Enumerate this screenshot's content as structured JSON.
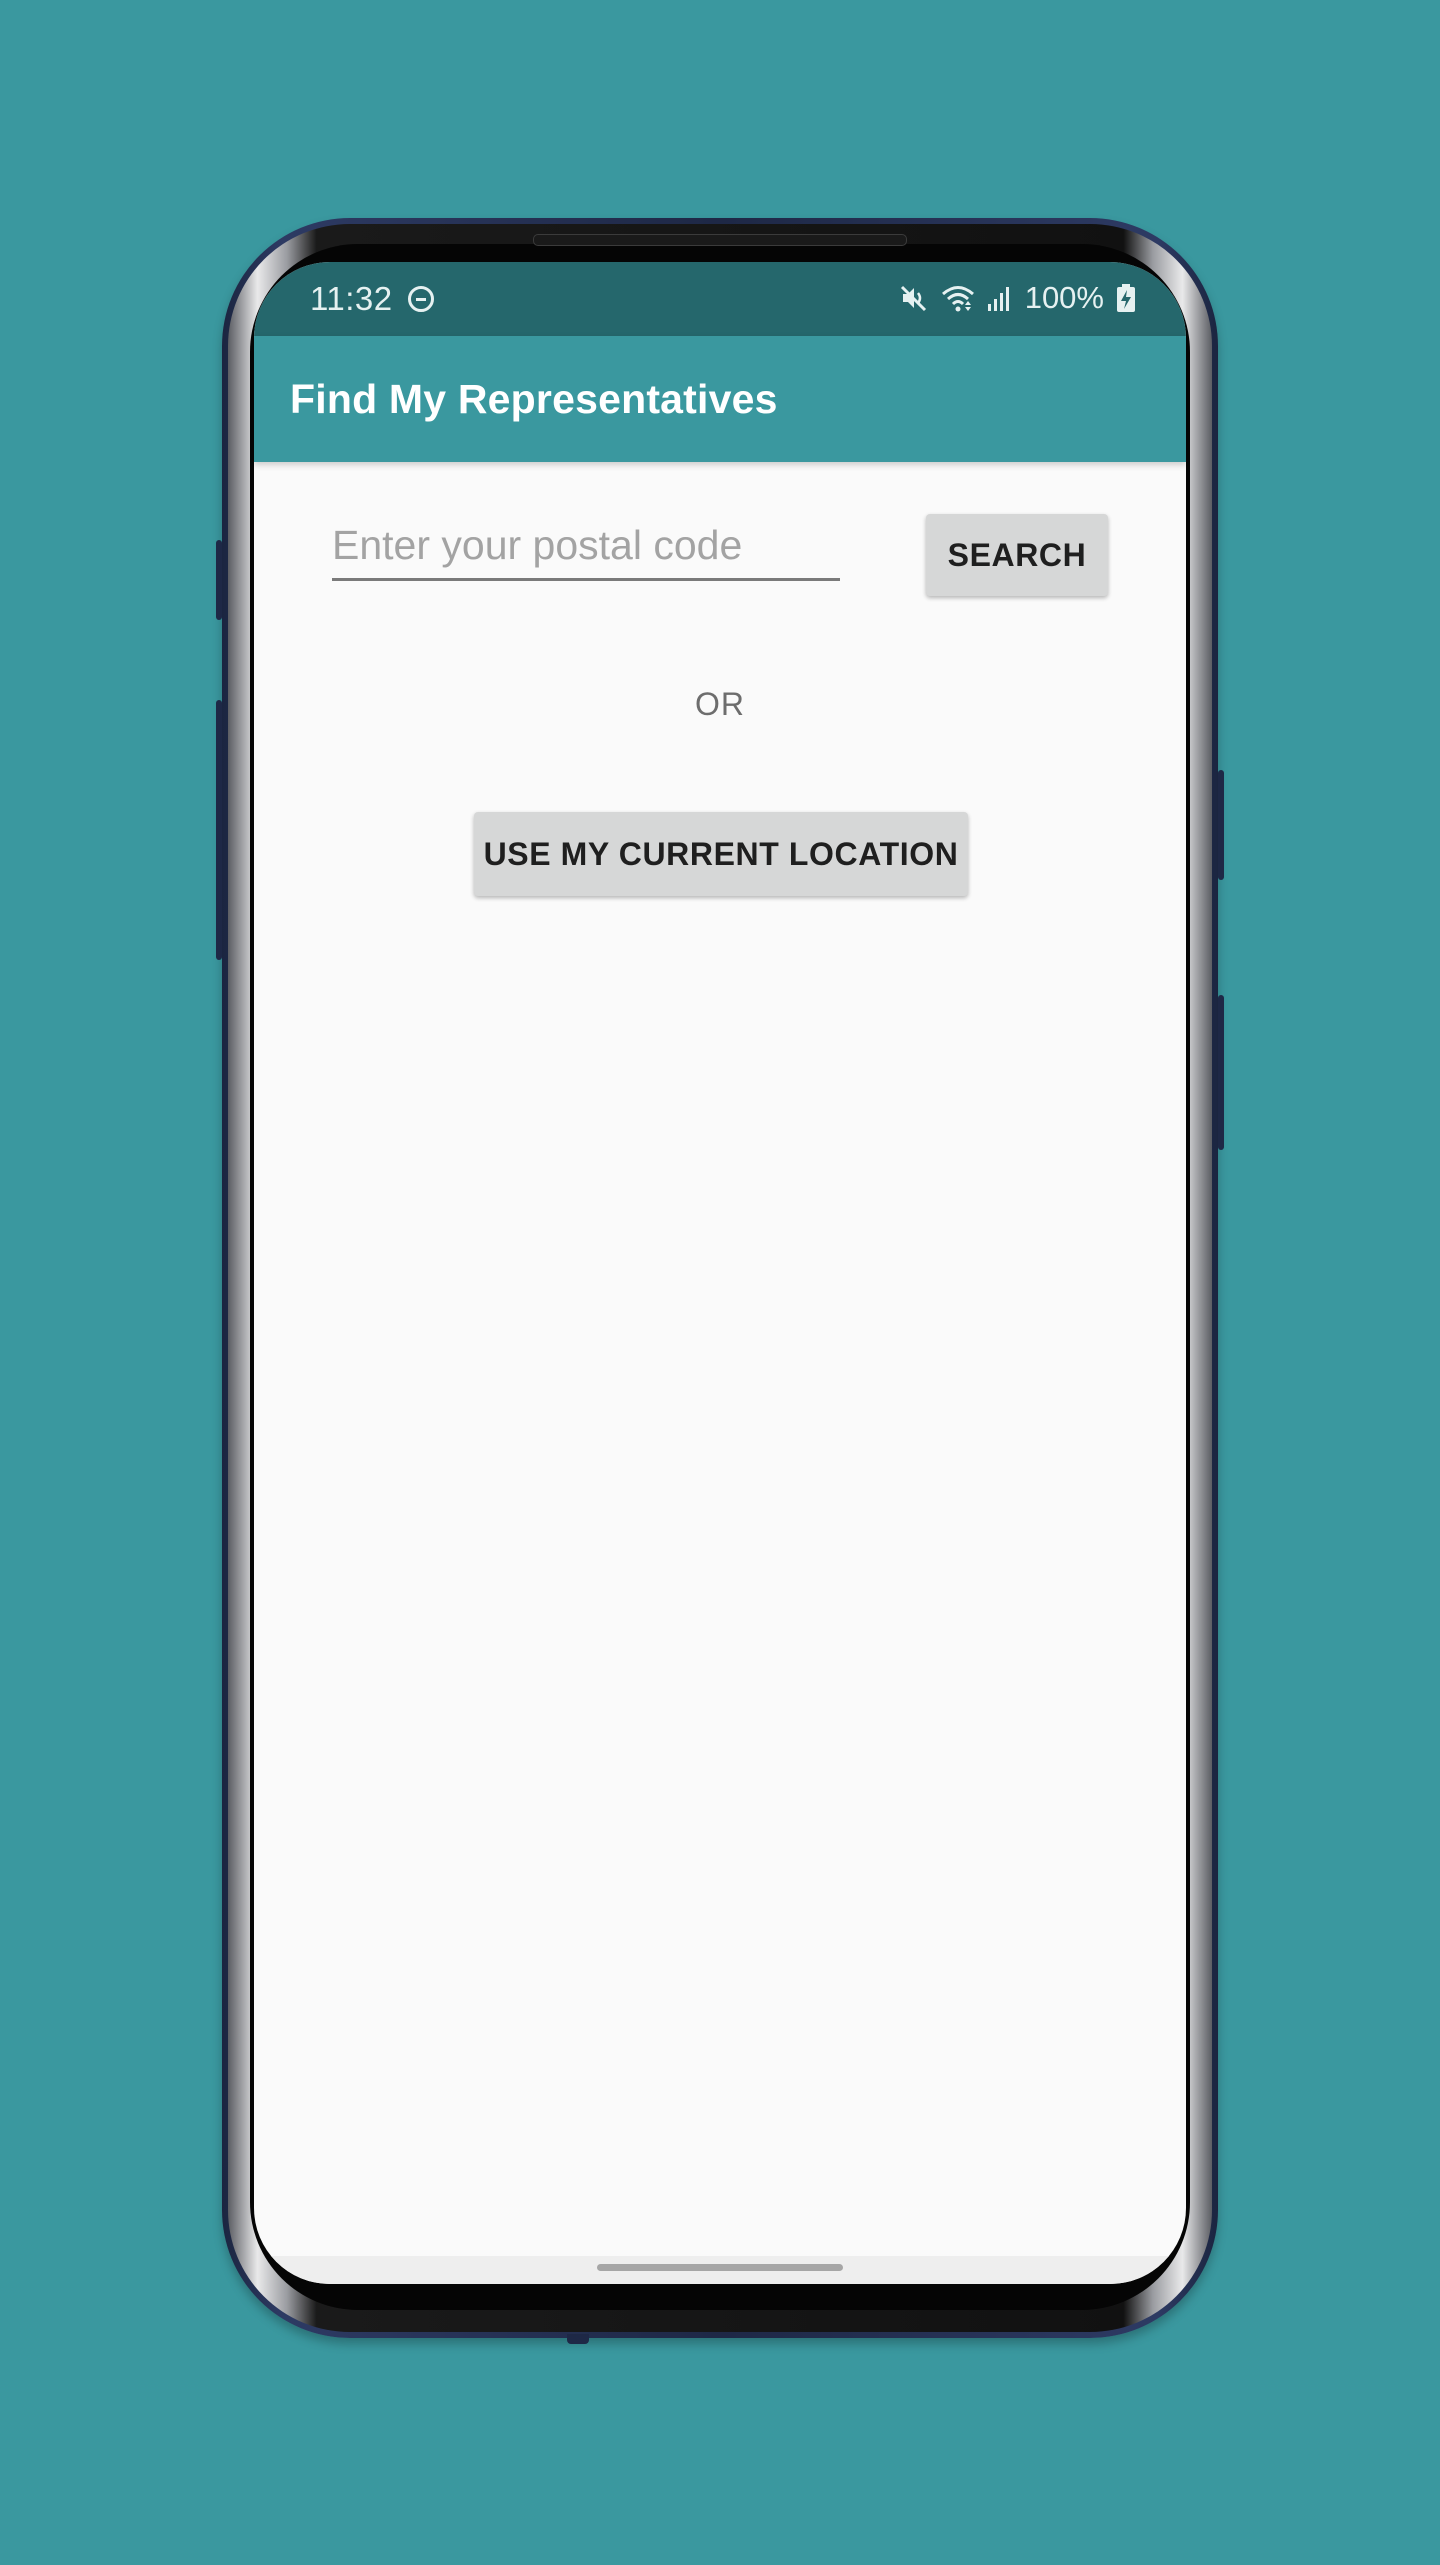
{
  "status_bar": {
    "time": "11:32",
    "battery": "100%",
    "icons": [
      "do-not-disturb-icon",
      "mute-icon",
      "wifi-icon",
      "signal-icon",
      "battery-charging-icon"
    ]
  },
  "app_bar": {
    "title": "Find My Representatives"
  },
  "search": {
    "placeholder": "Enter your postal code",
    "value": "",
    "button_label": "SEARCH"
  },
  "divider_label": "OR",
  "location_button_label": "USE MY CURRENT LOCATION",
  "colors": {
    "background": "#3a989f",
    "app_bar": "#3a989f",
    "status_bar": "#25676c",
    "screen": "#fafafa",
    "button": "#d6d7d7"
  }
}
